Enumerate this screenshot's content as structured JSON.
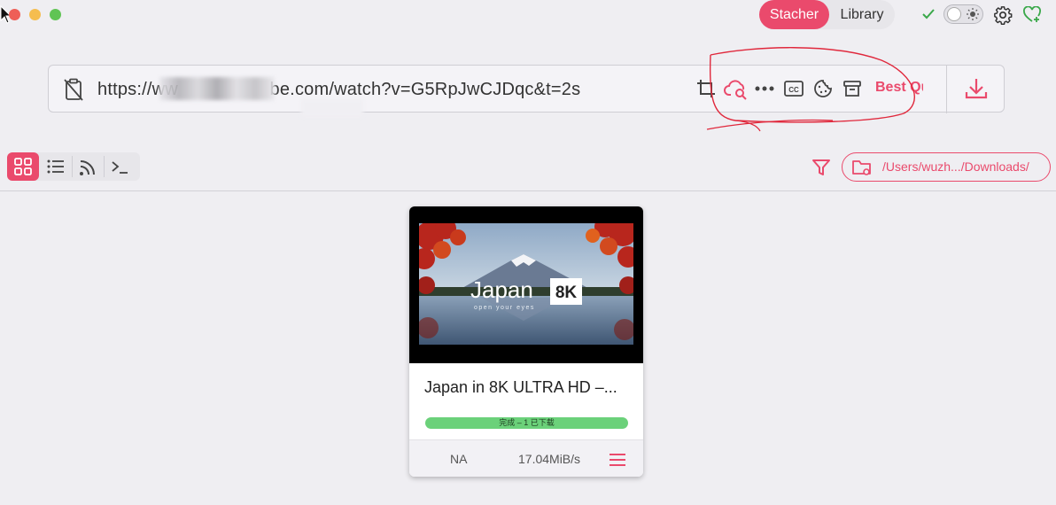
{
  "window": {
    "controls": [
      {
        "name": "close",
        "color": "#ee5f57"
      },
      {
        "name": "minimize",
        "color": "#f5bd4f"
      },
      {
        "name": "zoom",
        "color": "#60c454"
      }
    ]
  },
  "header": {
    "tabs": [
      {
        "label": "Stacher",
        "active": true
      },
      {
        "label": "Library",
        "active": false
      }
    ],
    "icons": [
      "check-icon",
      "theme-toggle",
      "gear-icon",
      "heart-plus-icon"
    ]
  },
  "url_bar": {
    "value": "https://ww                  be.com/watch?v=G5RpJwCJDqc&t=2s",
    "quality_label": "Best Qu",
    "tool_icons": [
      "crop-icon",
      "cloud-search-icon",
      "more-icon",
      "cc-icon",
      "cookie-icon",
      "archive-icon"
    ]
  },
  "toolbar": {
    "views": [
      "grid-view-icon",
      "list-view-icon",
      "rss-icon",
      "terminal-icon"
    ],
    "download_path": "/Users/wuzh.../Downloads/"
  },
  "card": {
    "title": "Japan in 8K ULTRA HD –...",
    "thumb_title": "Japan",
    "thumb_badge": "8K",
    "thumb_sub": "open your eyes",
    "status": "完成 – 1 已下载",
    "progress": 1.0,
    "size": "NA",
    "speed": "17.04MiB/s"
  },
  "colors": {
    "accent": "#ea4a6c",
    "success": "#6bd17a",
    "annotation": "#e0283c"
  }
}
